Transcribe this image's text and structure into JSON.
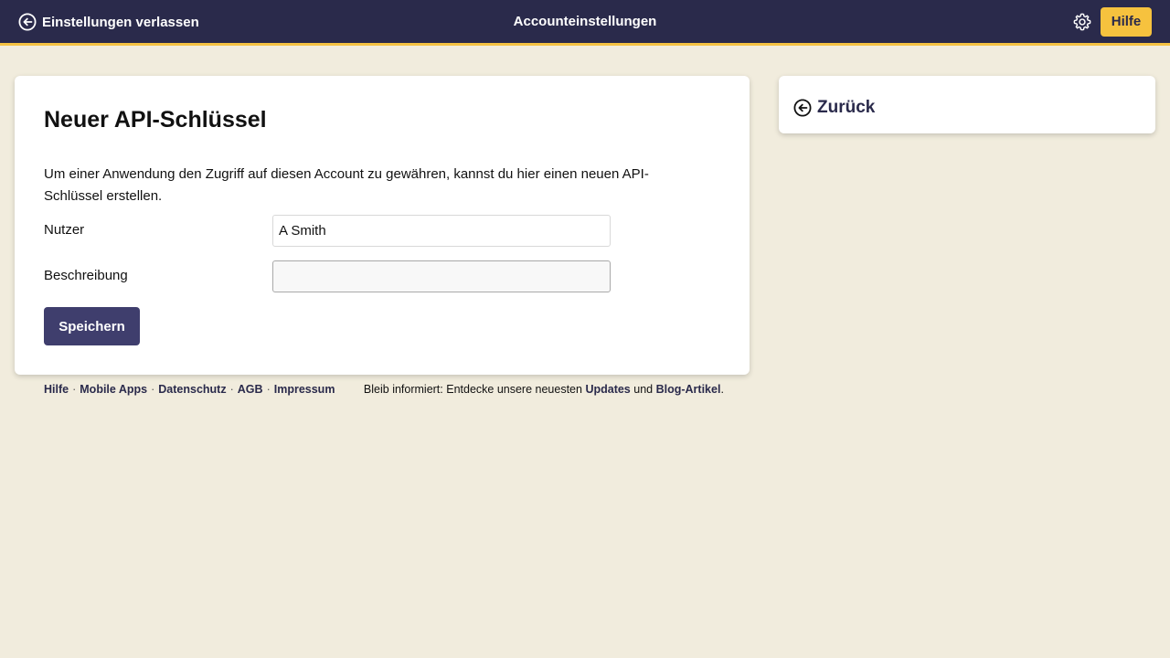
{
  "header": {
    "exit_label": "Einstellungen verlassen",
    "title": "Accounteinstellungen",
    "help_label": "Hilfe"
  },
  "form": {
    "title": "Neuer API-Schlüssel",
    "intro": "Um einer Anwendung den Zugriff auf diesen Account zu gewähren, kannst du hier einen neuen API-Schlüssel erstellen.",
    "user_label": "Nutzer",
    "user_value": "A Smith",
    "description_label": "Beschreibung",
    "description_value": "",
    "save_label": "Speichern"
  },
  "footer": {
    "links": [
      "Hilfe",
      "Mobile Apps",
      "Datenschutz",
      "AGB",
      "Impressum"
    ],
    "news_prefix": "Bleib informiert: Entdecke unsere neuesten",
    "news_updates": "Updates",
    "news_and": "und",
    "news_blog": "Blog-Artikel",
    "news_suffix": "."
  },
  "side": {
    "back_label": "Zurück"
  },
  "colors": {
    "background": "#f1ecdd",
    "topbar": "#2a2a4b",
    "accent": "#f6c23e",
    "primary_button": "#3f3e6d"
  }
}
